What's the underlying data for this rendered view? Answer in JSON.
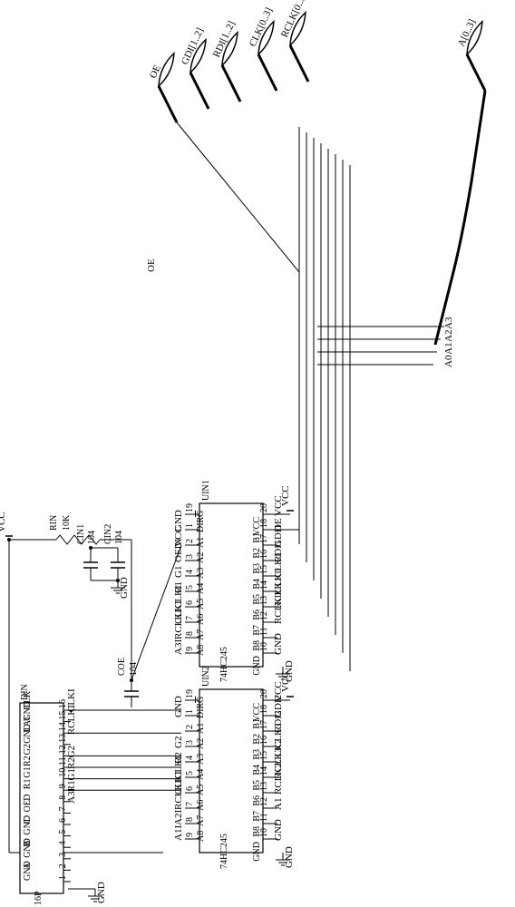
{
  "power": {
    "vcc": "VCC",
    "gnd": "GND"
  },
  "resistor": {
    "name": "RIN",
    "value": "10K"
  },
  "caps": {
    "cin1": {
      "name": "CIN1",
      "value": "104"
    },
    "cin2": {
      "name": "CIN2",
      "value": "104"
    },
    "coe": {
      "name": "COE",
      "value": "104"
    }
  },
  "connector": {
    "name": "DIN",
    "type": "16P",
    "pins": [
      {
        "n": "16",
        "label": "CLK",
        "net": "CLKI"
      },
      {
        "n": "15",
        "label": "GND",
        "net": ""
      },
      {
        "n": "14",
        "label": "LAT",
        "net": "RCLKI"
      },
      {
        "n": "13",
        "label": "GND",
        "net": ""
      },
      {
        "n": "12",
        "label": "G2",
        "net": "G2"
      },
      {
        "n": "11",
        "label": "R2",
        "net": "R2"
      },
      {
        "n": "10",
        "label": "G1",
        "net": "G1"
      },
      {
        "n": "9",
        "label": "R1",
        "net": "R1"
      },
      {
        "n": "8",
        "label": "D",
        "net": "A3I"
      },
      {
        "n": "7",
        "label": "OE",
        "net": ""
      },
      {
        "n": "6",
        "label": "C",
        "net": ""
      },
      {
        "n": "5",
        "label": "GND",
        "net": ""
      },
      {
        "n": "4",
        "label": "B",
        "net": ""
      },
      {
        "n": "3",
        "label": "GND",
        "net": ""
      },
      {
        "n": "2",
        "label": "A",
        "net": ""
      },
      {
        "n": "1",
        "label": "GND",
        "net": ""
      }
    ]
  },
  "ic1": {
    "ref": "UIN1",
    "part": "74HC245",
    "left": [
      {
        "n": "19",
        "label": "G",
        "bar": true,
        "net": ""
      },
      {
        "n": "1",
        "label": "DIR",
        "net": "GND"
      },
      {
        "n": "2",
        "label": "A1",
        "net": "VCC"
      },
      {
        "n": "3",
        "label": "A2",
        "net": "OEIN"
      },
      {
        "n": "4",
        "label": "A3",
        "net": "G1"
      },
      {
        "n": "5",
        "label": "A4",
        "net": "R1"
      },
      {
        "n": "6",
        "label": "A5",
        "net": "CLKI"
      },
      {
        "n": "7",
        "label": "A6",
        "net": "CLKI"
      },
      {
        "n": "8",
        "label": "A7",
        "net": "RCLKI"
      },
      {
        "n": "9",
        "label": "A8",
        "net": "A3I"
      }
    ],
    "right": [
      {
        "n": "20",
        "label": "VCC",
        "net": "VCC"
      },
      {
        "n": "18",
        "label": "B1",
        "net": "OE"
      },
      {
        "n": "17",
        "label": "B2",
        "net": "GDI1"
      },
      {
        "n": "16",
        "label": "B3",
        "net": "RDI1"
      },
      {
        "n": "15",
        "label": "B4",
        "net": "CLK1"
      },
      {
        "n": "14",
        "label": "B5",
        "net": "CLK0"
      },
      {
        "n": "13",
        "label": "B6",
        "net": "RCLK1"
      },
      {
        "n": "12",
        "label": "B7",
        "net": "RCLK0"
      },
      {
        "n": "11",
        "label": "B8",
        "net": ""
      },
      {
        "n": "10",
        "label": "GND",
        "net": "GND"
      }
    ]
  },
  "ic2": {
    "ref": "UIN2",
    "part": "74HC245",
    "left": [
      {
        "n": "19",
        "label": "G",
        "bar": true,
        "net": ""
      },
      {
        "n": "1",
        "label": "DIR",
        "net": "GND"
      },
      {
        "n": "2",
        "label": "A1",
        "net": ""
      },
      {
        "n": "3",
        "label": "A2",
        "net": "G2"
      },
      {
        "n": "4",
        "label": "A3",
        "net": "R2"
      },
      {
        "n": "5",
        "label": "A4",
        "net": "CLKI"
      },
      {
        "n": "6",
        "label": "A5",
        "net": "CLKI"
      },
      {
        "n": "7",
        "label": "A6",
        "net": "RCLKI"
      },
      {
        "n": "8",
        "label": "A7",
        "net": "A2I"
      },
      {
        "n": "9",
        "label": "A8",
        "net": "A1I"
      }
    ],
    "right": [
      {
        "n": "20",
        "label": "VCC",
        "net": "VCC"
      },
      {
        "n": "18",
        "label": "B1",
        "net": "GDI2"
      },
      {
        "n": "17",
        "label": "B2",
        "net": "RDI2"
      },
      {
        "n": "16",
        "label": "B3",
        "net": "CLK3"
      },
      {
        "n": "15",
        "label": "B4",
        "net": "CLK2"
      },
      {
        "n": "14",
        "label": "B5",
        "net": "RCLK3"
      },
      {
        "n": "13",
        "label": "B6",
        "net": "RCLK2"
      },
      {
        "n": "12",
        "label": "B7",
        "net": "A1"
      },
      {
        "n": "11",
        "label": "B8",
        "net": ""
      },
      {
        "n": "10",
        "label": "GND",
        "net": "GND"
      }
    ]
  },
  "buses": [
    {
      "name": "OE"
    },
    {
      "name": "GDI[1..2]"
    },
    {
      "name": "RDI[1..2]"
    },
    {
      "name": "CLK[0..3]"
    },
    {
      "name": "RCLK[0..3]"
    },
    {
      "name": "A[0..3]"
    }
  ],
  "a_bus_members": [
    "A3",
    "A2",
    "A1",
    "A0"
  ]
}
